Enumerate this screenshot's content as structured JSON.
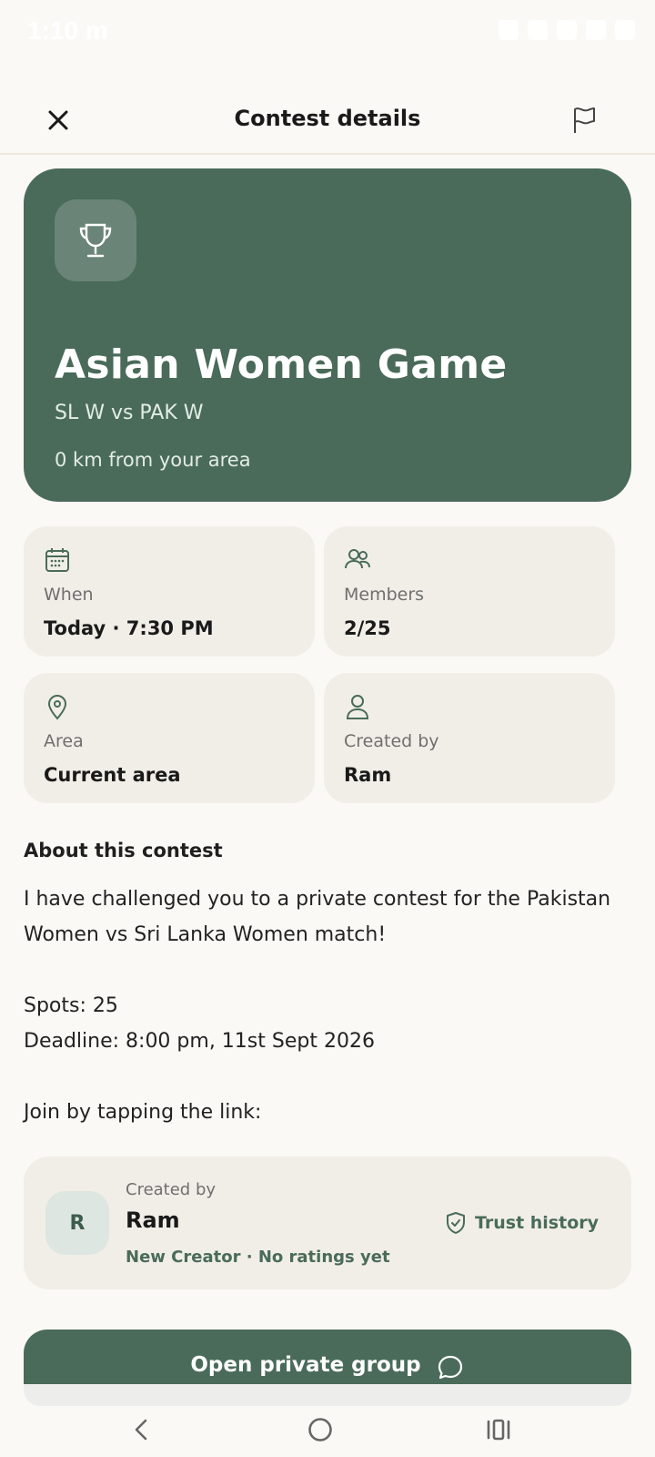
{
  "status_bar": {
    "time": "1:10 m"
  },
  "header": {
    "title": "Contest details"
  },
  "hero": {
    "title": "Asian Women Game",
    "match": "SL W vs PAK W",
    "distance": "0 km from your area",
    "color": "#4a6b5a"
  },
  "info_cards": [
    {
      "icon": "calendar-icon",
      "label": "When",
      "value": "Today · 7:30 PM"
    },
    {
      "icon": "members-icon",
      "label": "Members",
      "value": "2/25"
    },
    {
      "icon": "location-pin-icon",
      "label": "Area",
      "value": "Current area"
    },
    {
      "icon": "user-icon",
      "label": "Created by",
      "value": "Ram"
    }
  ],
  "about": {
    "heading": "About this contest",
    "body": "I have challenged you to a private contest for the Pakistan Women vs Sri Lanka Women match!\n\nSpots: 25\nDeadline: 8:00 pm, 11st Sept 2026\n\nJoin by tapping the link:"
  },
  "creator": {
    "label": "Created by",
    "initial": "R",
    "name": "Ram",
    "meta": "New Creator · No ratings yet",
    "trust_label": "Trust history"
  },
  "primary_button": {
    "label": "Open private group"
  },
  "colors": {
    "accent": "#4a6b5a",
    "card_bg": "#f1eee8",
    "page_bg": "#fbf9f5"
  }
}
